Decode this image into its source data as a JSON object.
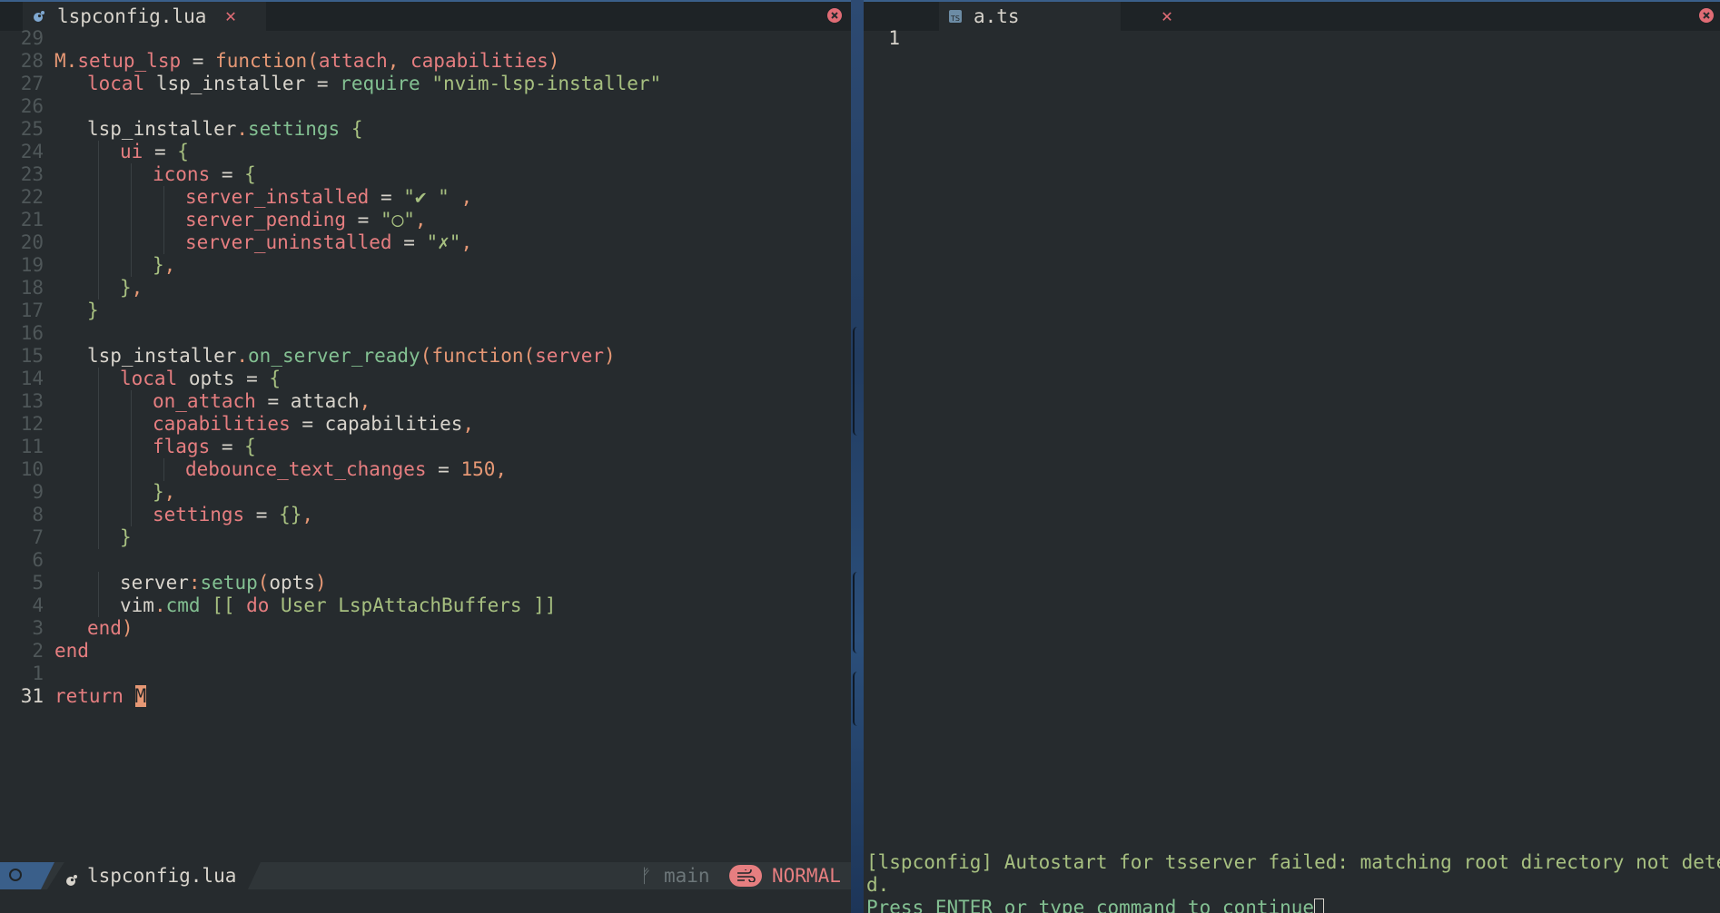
{
  "left": {
    "tab_label": "lspconfig.lua",
    "lines": [
      {
        "ln": "29",
        "indent": 0,
        "tokens": []
      },
      {
        "ln": "28",
        "indent": 0,
        "tokens": [
          {
            "t": "M",
            "c": "p"
          },
          {
            "t": ".",
            "c": "p"
          },
          {
            "t": "setup_lsp",
            "c": "k"
          },
          {
            "t": " = ",
            "c": "v"
          },
          {
            "t": "function",
            "c": "f"
          },
          {
            "t": "(",
            "c": "p"
          },
          {
            "t": "attach",
            "c": "k"
          },
          {
            "t": ", ",
            "c": "p"
          },
          {
            "t": "capabilities",
            "c": "k"
          },
          {
            "t": ")",
            "c": "p"
          }
        ]
      },
      {
        "ln": "27",
        "indent": 1,
        "tokens": [
          {
            "t": "local ",
            "c": "k"
          },
          {
            "t": "lsp_installer",
            "c": "v"
          },
          {
            "t": " = ",
            "c": "v"
          },
          {
            "t": "require ",
            "c": "g"
          },
          {
            "t": "\"nvim-lsp-installer\"",
            "c": "s"
          }
        ]
      },
      {
        "ln": "26",
        "indent": 0,
        "tokens": []
      },
      {
        "ln": "25",
        "indent": 1,
        "tokens": [
          {
            "t": "lsp_installer",
            "c": "v"
          },
          {
            "t": ".",
            "c": "p"
          },
          {
            "t": "settings",
            "c": "g"
          },
          {
            "t": " {",
            "c": "s"
          }
        ]
      },
      {
        "ln": "24",
        "indent": 2,
        "tokens": [
          {
            "t": "ui",
            "c": "k"
          },
          {
            "t": " = ",
            "c": "v"
          },
          {
            "t": "{",
            "c": "s"
          }
        ]
      },
      {
        "ln": "23",
        "indent": 3,
        "tokens": [
          {
            "t": "icons",
            "c": "k"
          },
          {
            "t": " = ",
            "c": "v"
          },
          {
            "t": "{",
            "c": "s"
          }
        ]
      },
      {
        "ln": "22",
        "indent": 4,
        "tokens": [
          {
            "t": "server_installed",
            "c": "k"
          },
          {
            "t": " = ",
            "c": "v"
          },
          {
            "t": "\"✔ \"",
            "c": "s"
          },
          {
            "t": " ,",
            "c": "p"
          }
        ]
      },
      {
        "ln": "21",
        "indent": 4,
        "tokens": [
          {
            "t": "server_pending",
            "c": "k"
          },
          {
            "t": " = ",
            "c": "v"
          },
          {
            "t": "\"◯\"",
            "c": "s"
          },
          {
            "t": ",",
            "c": "p"
          }
        ]
      },
      {
        "ln": "20",
        "indent": 4,
        "tokens": [
          {
            "t": "server_uninstalled",
            "c": "k"
          },
          {
            "t": " = ",
            "c": "v"
          },
          {
            "t": "\"✗\"",
            "c": "s"
          },
          {
            "t": ",",
            "c": "p"
          }
        ]
      },
      {
        "ln": "19",
        "indent": 3,
        "tokens": [
          {
            "t": "}",
            "c": "s"
          },
          {
            "t": ",",
            "c": "p"
          }
        ]
      },
      {
        "ln": "18",
        "indent": 2,
        "tokens": [
          {
            "t": "}",
            "c": "s"
          },
          {
            "t": ",",
            "c": "p"
          }
        ]
      },
      {
        "ln": "17",
        "indent": 1,
        "tokens": [
          {
            "t": "}",
            "c": "s"
          }
        ]
      },
      {
        "ln": "16",
        "indent": 0,
        "tokens": []
      },
      {
        "ln": "15",
        "indent": 1,
        "tokens": [
          {
            "t": "lsp_installer",
            "c": "v"
          },
          {
            "t": ".",
            "c": "p"
          },
          {
            "t": "on_server_ready",
            "c": "g"
          },
          {
            "t": "(",
            "c": "p"
          },
          {
            "t": "function",
            "c": "f"
          },
          {
            "t": "(",
            "c": "p"
          },
          {
            "t": "server",
            "c": "k"
          },
          {
            "t": ")",
            "c": "p"
          }
        ]
      },
      {
        "ln": "14",
        "indent": 2,
        "tokens": [
          {
            "t": "local ",
            "c": "k"
          },
          {
            "t": "opts",
            "c": "v"
          },
          {
            "t": " = ",
            "c": "v"
          },
          {
            "t": "{",
            "c": "s"
          }
        ]
      },
      {
        "ln": "13",
        "indent": 3,
        "tokens": [
          {
            "t": "on_attach",
            "c": "k"
          },
          {
            "t": " = ",
            "c": "v"
          },
          {
            "t": "attach",
            "c": "v"
          },
          {
            "t": ",",
            "c": "p"
          }
        ]
      },
      {
        "ln": "12",
        "indent": 3,
        "tokens": [
          {
            "t": "capabilities",
            "c": "k"
          },
          {
            "t": " = ",
            "c": "v"
          },
          {
            "t": "capabilities",
            "c": "v"
          },
          {
            "t": ",",
            "c": "p"
          }
        ]
      },
      {
        "ln": "11",
        "indent": 3,
        "tokens": [
          {
            "t": "flags",
            "c": "k"
          },
          {
            "t": " = ",
            "c": "v"
          },
          {
            "t": "{",
            "c": "s"
          }
        ]
      },
      {
        "ln": "10",
        "indent": 4,
        "tokens": [
          {
            "t": "debounce_text_changes",
            "c": "k"
          },
          {
            "t": " = ",
            "c": "v"
          },
          {
            "t": "150",
            "c": "n"
          },
          {
            "t": ",",
            "c": "p"
          }
        ]
      },
      {
        "ln": "9",
        "indent": 3,
        "tokens": [
          {
            "t": "}",
            "c": "s"
          },
          {
            "t": ",",
            "c": "p"
          }
        ]
      },
      {
        "ln": "8",
        "indent": 3,
        "tokens": [
          {
            "t": "settings",
            "c": "k"
          },
          {
            "t": " = ",
            "c": "v"
          },
          {
            "t": "{}",
            "c": "s"
          },
          {
            "t": ",",
            "c": "p"
          }
        ]
      },
      {
        "ln": "7",
        "indent": 2,
        "tokens": [
          {
            "t": "}",
            "c": "s"
          }
        ]
      },
      {
        "ln": "6",
        "indent": 0,
        "tokens": []
      },
      {
        "ln": "5",
        "indent": 2,
        "tokens": [
          {
            "t": "server",
            "c": "v"
          },
          {
            "t": ":",
            "c": "p"
          },
          {
            "t": "setup",
            "c": "g"
          },
          {
            "t": "(",
            "c": "p"
          },
          {
            "t": "opts",
            "c": "v"
          },
          {
            "t": ")",
            "c": "p"
          }
        ]
      },
      {
        "ln": "4",
        "indent": 2,
        "tokens": [
          {
            "t": "vim",
            "c": "v"
          },
          {
            "t": ".",
            "c": "p"
          },
          {
            "t": "cmd",
            "c": "g"
          },
          {
            "t": " [[ ",
            "c": "s"
          },
          {
            "t": "do ",
            "c": "k"
          },
          {
            "t": "User LspAttachBuffers",
            "c": "s"
          },
          {
            "t": " ]]",
            "c": "s"
          }
        ]
      },
      {
        "ln": "3",
        "indent": 1,
        "tokens": [
          {
            "t": "end",
            "c": "k"
          },
          {
            "t": ")",
            "c": "p"
          }
        ]
      },
      {
        "ln": "2",
        "indent": 0,
        "tokens": [
          {
            "t": "end",
            "c": "k"
          }
        ]
      },
      {
        "ln": "1",
        "indent": 0,
        "tokens": []
      },
      {
        "ln": "31",
        "indent": 0,
        "current": true,
        "tokens": [
          {
            "t": "return ",
            "c": "k"
          },
          {
            "t": "M",
            "c": "cursor"
          }
        ]
      }
    ],
    "status": {
      "filename": "lspconfig.lua",
      "branch": "main",
      "mode": "NORMAL"
    }
  },
  "right": {
    "tab_label": "a.ts",
    "lines": [
      {
        "ln": "1",
        "tokens": []
      }
    ],
    "cmdline": [
      "[lspconfig] Autostart for tsserver failed: matching root directory not detecte",
      "d.",
      "Press ENTER or type command to continue"
    ]
  },
  "colors": {
    "bg": "#262b2e",
    "red": "#e67e80",
    "orange": "#e69875",
    "green": "#a7c080",
    "aqua": "#83c092",
    "fg": "#d8d4cc"
  }
}
